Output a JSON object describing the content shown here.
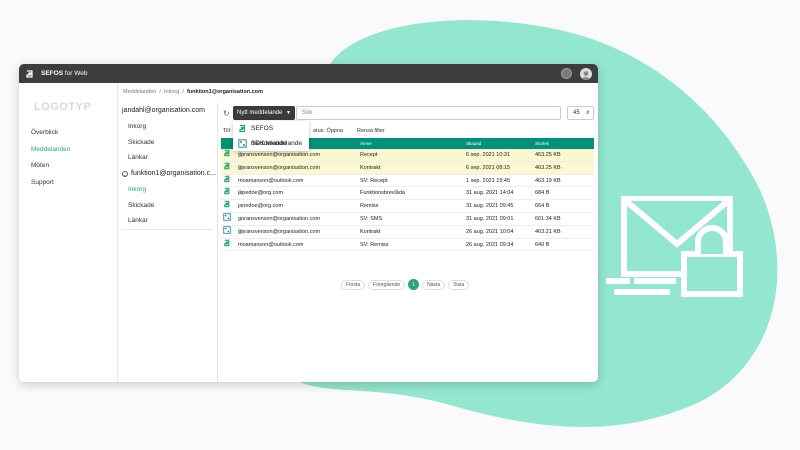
{
  "window": {
    "app_name_bold": "SEFOS",
    "app_name_rest": " for Web"
  },
  "sidebar": {
    "logo": "LOGOTYP",
    "items": [
      {
        "label": "Överblick",
        "active": false
      },
      {
        "label": "Meddelanden",
        "active": true
      },
      {
        "label": "Möten",
        "active": false
      },
      {
        "label": "Support",
        "active": false
      }
    ]
  },
  "breadcrumb": {
    "part1": "Meddelanden",
    "sep": "/",
    "part2": "Inkorg",
    "current": "funktion1@organisation.com"
  },
  "folders": {
    "account1": "jandahl@organisation.com",
    "account1_folders": [
      "Inkorg",
      "Skickade",
      "Länkar"
    ],
    "account2": "funktion1@organisation.c...",
    "account2_folders": [
      "Inkorg",
      "Skickade",
      "Länkar"
    ]
  },
  "toolbar": {
    "new_message": "Nytt meddelande",
    "search_placeholder": "Sök",
    "page_size": "45"
  },
  "dropdown": {
    "items": [
      "SEFOS meddelande",
      "SDK meddelande"
    ]
  },
  "filters": {
    "f1": "Till:",
    "f2": "atus: Öppna",
    "f3": "Rensa filter"
  },
  "table": {
    "headers": {
      "subject": "Ämne",
      "created": "Skapad",
      "size": "Storlek"
    },
    "rows": [
      {
        "icon": "sefos",
        "clip": true,
        "from": "goransvenson@organisation.com",
        "subject": "Recept",
        "date": "6 sep. 2021 10:31",
        "size": "463.25 KB",
        "unread": true
      },
      {
        "icon": "sefos",
        "clip": true,
        "from": "goransvenson@organisation.com",
        "subject": "Kontrakt",
        "date": "6 sep. 2021 08:15",
        "size": "463.25 KB",
        "unread": true
      },
      {
        "icon": "sefos",
        "clip": false,
        "from": "moamanson@outlook.com",
        "subject": "SV: Recept",
        "date": "1 sep. 2021 15:45",
        "size": "463.19 KB",
        "unread": false
      },
      {
        "icon": "sefos",
        "clip": true,
        "from": "janedoe@org.com",
        "subject": "Funktionsbrevlåda",
        "date": "31 aug. 2021 14:04",
        "size": "684 B",
        "unread": false
      },
      {
        "icon": "sefos",
        "clip": false,
        "from": "janedoe@org.com",
        "subject": "Remiss",
        "date": "31 aug. 2021 09:45",
        "size": "664 B",
        "unread": false
      },
      {
        "icon": "sdk",
        "clip": false,
        "from": "goransvenson@organisation.com",
        "subject": "SV: SMS",
        "date": "31 aug. 2021 09:01",
        "size": "601.34 KB",
        "unread": false
      },
      {
        "icon": "sdk",
        "clip": true,
        "from": "goransvenson@organisation.com",
        "subject": "Kontrakt",
        "date": "26 aug. 2021 10:04",
        "size": "463.21 KB",
        "unread": false
      },
      {
        "icon": "sefos",
        "clip": false,
        "from": "moamanson@outlook.com",
        "subject": "SV: Remiss",
        "date": "26 aug. 2021 09:34",
        "size": "640 B",
        "unread": false
      }
    ]
  },
  "pager": {
    "first": "Första",
    "prev": "Föregående",
    "current": "1",
    "next": "Nästa",
    "last": "Sista"
  },
  "colors": {
    "accent": "#2aa678",
    "header": "#00917a",
    "blob": "#93e6cf",
    "unread": "#fbf7d0"
  }
}
